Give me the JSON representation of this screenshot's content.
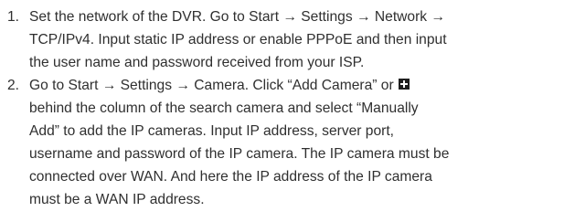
{
  "steps": [
    {
      "number": "1.",
      "lines": [
        "Set the network of the DVR. Go to Start → Settings → Network →",
        "TCP/IPv4. Input static IP address or enable PPPoE and then input",
        "the user name and password received from your ISP."
      ]
    },
    {
      "number": "2.",
      "lines": [
        "Go to Start → Settings → Camera. Click “Add Camera” or",
        "behind the column of the search camera and select “Manually",
        "Add” to add the IP cameras. Input IP address, server port,",
        "username and password of the IP camera. The IP camera must be",
        "connected over WAN. And here the IP address of the IP camera",
        "must be a WAN IP address."
      ],
      "inline_icon": "plus-square-icon"
    }
  ]
}
